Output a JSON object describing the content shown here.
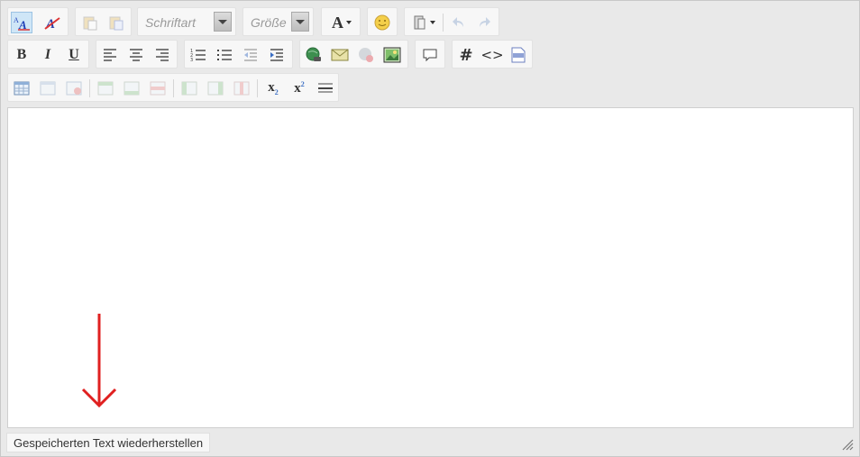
{
  "toolbar": {
    "font_placeholder": "Schriftart",
    "size_placeholder": "Größe",
    "font_color_label": "A",
    "bold_label": "B",
    "italic_label": "I",
    "underline_label": "U",
    "hash_label": "#",
    "source_label": "<>",
    "subscript_label": "x",
    "subscript_sub": "2",
    "superscript_label": "x",
    "superscript_sup": "2",
    "icons": [
      "spellcheck-icon",
      "remove-format-icon",
      "paste-icon",
      "paste-word-icon",
      "font-color-icon",
      "smiley-icon",
      "clipboard-icon",
      "undo-icon",
      "redo-icon",
      "bold-icon",
      "italic-icon",
      "underline-icon",
      "align-left-icon",
      "align-center-icon",
      "align-right-icon",
      "numbered-list-icon",
      "bulleted-list-icon",
      "outdent-icon",
      "indent-icon",
      "link-icon",
      "email-icon",
      "unlink-icon",
      "image-icon",
      "comment-icon",
      "hash-icon",
      "source-code-icon",
      "php-icon",
      "table-icon",
      "table-properties-icon",
      "delete-table-icon",
      "insert-row-before-icon",
      "insert-row-after-icon",
      "delete-row-icon",
      "insert-column-before-icon",
      "insert-column-after-icon",
      "delete-column-icon",
      "subscript-icon",
      "superscript-icon",
      "horizontal-rule-icon"
    ]
  },
  "footer": {
    "restore_label": "Gespeicherten Text wiederherstellen"
  },
  "colors": {
    "arrow": "#e02020",
    "toolbar_bg": "#e9e9e9",
    "button_active": "#cfe6f7"
  }
}
